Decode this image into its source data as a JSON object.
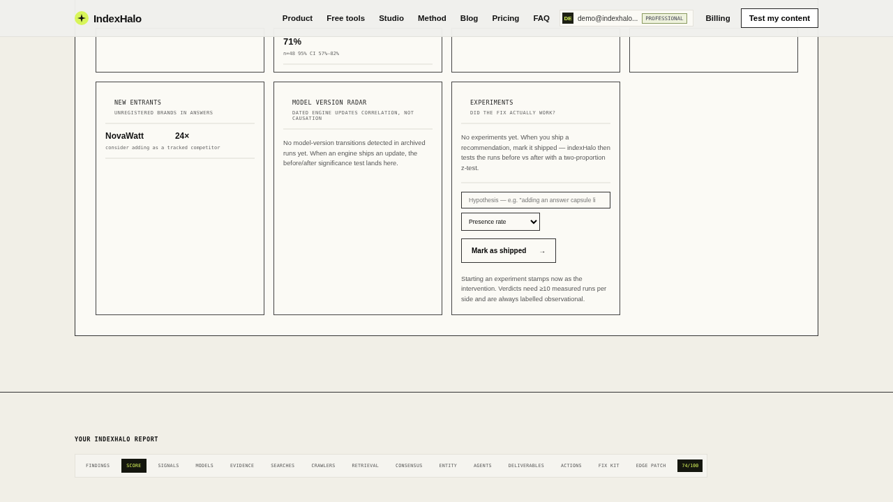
{
  "header": {
    "logo": "IndexHalo",
    "nav": [
      "Product",
      "Free tools",
      "Studio",
      "Method",
      "Blog",
      "Pricing",
      "FAQ"
    ],
    "account": {
      "initials": "DE",
      "email": "demo@indexhalo...",
      "plan": "PROFESSIONAL"
    },
    "billing": "Billing",
    "cta": "Test my content"
  },
  "top_cards": [
    {
      "kind": "empty"
    },
    {
      "kind": "stat",
      "value": "71%",
      "note": "n=48   95% CI 57%–82%"
    },
    {
      "kind": "empty"
    },
    {
      "kind": "empty"
    }
  ],
  "cards": [
    {
      "kind": "entrants",
      "title": "NEW ENTRANTS",
      "subtitle": "UNREGISTERED BRANDS IN ANSWERS",
      "brand": "NovaWatt",
      "count": "24×",
      "hint": "consider adding as a tracked competitor"
    },
    {
      "kind": "radar",
      "title": "MODEL VERSION RADAR",
      "subtitle": "DATED ENGINE UPDATES   CORRELATION, NOT CAUSATION",
      "body": "No model-version transitions detected in archived runs yet. When an engine ships an update, the before/after significance test lands here."
    },
    {
      "kind": "experiments",
      "title": "EXPERIMENTS",
      "subtitle": "DID THE FIX ACTUALLY WORK?",
      "body": "No experiments yet. When you ship a recommendation, mark it shipped — indexHalo then tests the runs before vs after with a two-proportion z-test.",
      "placeholder": "Hypothesis — e.g. \"adding an answer capsule li",
      "metric": "Presence rate",
      "button": "Mark as shipped",
      "arrow": "→",
      "footnote": "Starting an experiment stamps now as the intervention. Verdicts need ≥10 measured runs per side and are always labelled observational."
    }
  ],
  "report": {
    "title": "YOUR INDEXHALO REPORT",
    "tabs": [
      {
        "label": "FINDINGS",
        "selected": false
      },
      {
        "label": "SCORE",
        "selected": true
      },
      {
        "label": "SIGNALS",
        "selected": false
      },
      {
        "label": "MODELS",
        "selected": false
      },
      {
        "label": "EVIDENCE",
        "selected": false
      },
      {
        "label": "SEARCHES",
        "selected": false
      },
      {
        "label": "CRAWLERS",
        "selected": false
      },
      {
        "label": "RETRIEVAL",
        "selected": false
      },
      {
        "label": "CONSENSUS",
        "selected": false
      },
      {
        "label": "ENTITY",
        "selected": false
      },
      {
        "label": "AGENTS",
        "selected": false
      },
      {
        "label": "DELIVERABLES",
        "selected": false
      },
      {
        "label": "ACTIONS",
        "selected": false
      },
      {
        "label": "FIX KIT",
        "selected": false
      },
      {
        "label": "EDGE PATCH",
        "selected": false
      }
    ],
    "score": "74/100"
  }
}
